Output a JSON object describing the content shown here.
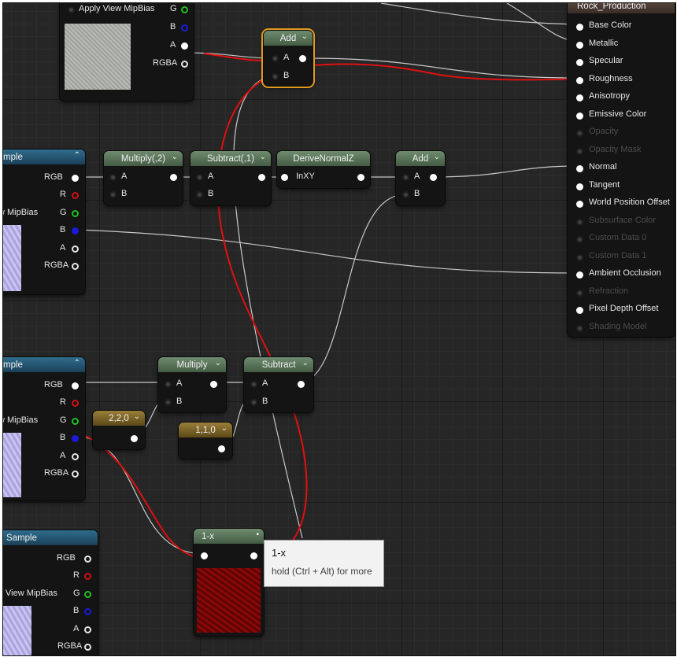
{
  "material_node": {
    "title": "Rock_Production",
    "inputs": [
      {
        "label": "Base Color",
        "active": true
      },
      {
        "label": "Metallic",
        "active": true
      },
      {
        "label": "Specular",
        "active": true
      },
      {
        "label": "Roughness",
        "active": true
      },
      {
        "label": "Anisotropy",
        "active": true
      },
      {
        "label": "Emissive Color",
        "active": true
      },
      {
        "label": "Opacity",
        "active": false
      },
      {
        "label": "Opacity Mask",
        "active": false
      },
      {
        "label": "Normal",
        "active": true
      },
      {
        "label": "Tangent",
        "active": true
      },
      {
        "label": "World Position Offset",
        "active": true
      },
      {
        "label": "Subsurface Color",
        "active": false
      },
      {
        "label": "Custom Data 0",
        "active": false
      },
      {
        "label": "Custom Data 1",
        "active": false
      },
      {
        "label": "Ambient Occlusion",
        "active": true
      },
      {
        "label": "Refraction",
        "active": false
      },
      {
        "label": "Pixel Depth Offset",
        "active": true
      },
      {
        "label": "Shading Model",
        "active": false
      }
    ]
  },
  "top_sample": {
    "mipbias": "Apply View MipBias",
    "g": "G",
    "b": "B",
    "a": "A",
    "rgba": "RGBA"
  },
  "sample1": {
    "title": "mple",
    "rgb": "RGB",
    "r": "R",
    "mipbias": "w MipBias",
    "g": "G",
    "b": "B",
    "a": "A",
    "rgba": "RGBA"
  },
  "sample2": {
    "title": "mple",
    "rgb": "RGB",
    "r": "R",
    "mipbias": "w MipBias",
    "g": "G",
    "b": "B",
    "a": "A",
    "rgba": "RGBA"
  },
  "sample3": {
    "title": "Sample",
    "rgb": "RGB",
    "r": "R",
    "mipbias": "View MipBias",
    "g": "G",
    "b": "B",
    "a": "A",
    "rgba": "RGBA"
  },
  "add_top": {
    "title": "Add",
    "a": "A",
    "b": "B"
  },
  "multiply1": {
    "title": "Multiply(,2)",
    "a": "A",
    "b": "B"
  },
  "subtract1": {
    "title": "Subtract(,1)",
    "a": "A",
    "b": "B"
  },
  "derive": {
    "title": "DeriveNormalZ",
    "input": "InXY"
  },
  "add2": {
    "title": "Add",
    "a": "A",
    "b": "B"
  },
  "multiply2": {
    "title": "Multiply",
    "a": "A",
    "b": "B"
  },
  "subtract2": {
    "title": "Subtract",
    "a": "A",
    "b": "B"
  },
  "const_220": {
    "title": "2,2,0"
  },
  "const_110": {
    "title": "1,1,0"
  },
  "one_minus": {
    "title": "1-x"
  },
  "tooltip": {
    "title": "1-x",
    "hint": "hold (Ctrl + Alt) for more"
  },
  "colors": {
    "accent_red": "#e01010",
    "selection": "#e09a20",
    "wire": "#c8c8c8"
  }
}
